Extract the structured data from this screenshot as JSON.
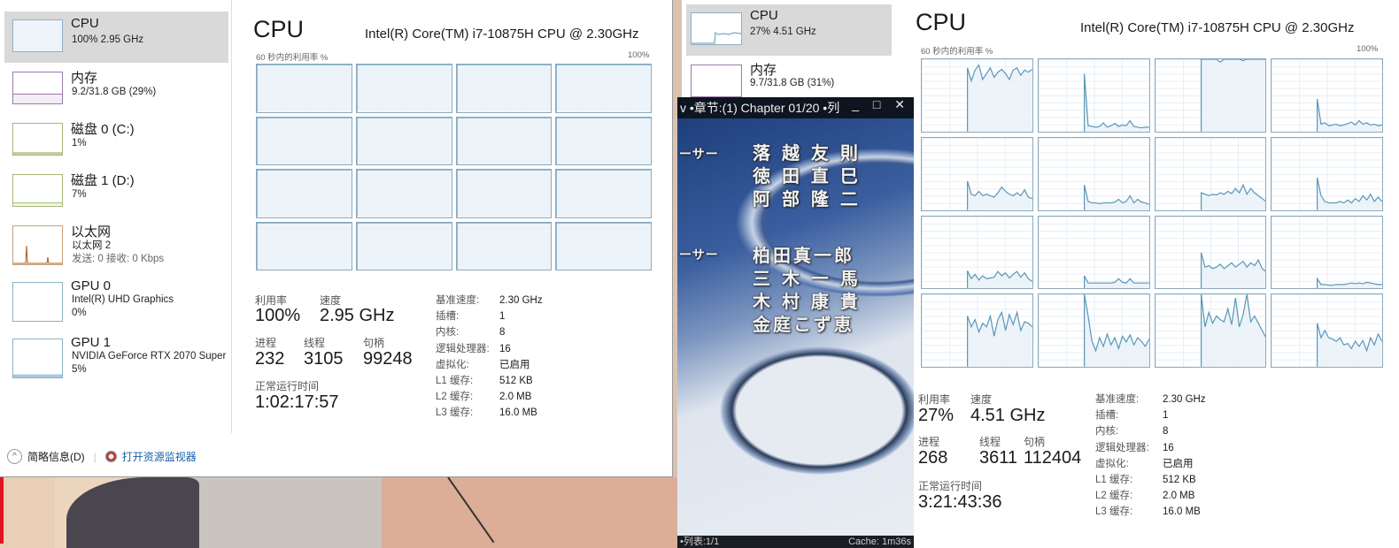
{
  "left_window": {
    "sidebar": [
      {
        "name": "CPU",
        "sub": "100% 2.95 GHz",
        "color": "#4f8fbf",
        "selected": true
      },
      {
        "name": "内存",
        "sub": "9.2/31.8 GB (29%)",
        "color": "#8b4f9f"
      },
      {
        "name": "磁盘 0 (C:)",
        "sub": "1%",
        "color": "#6a9a2a"
      },
      {
        "name": "磁盘 1 (D:)",
        "sub": "7%",
        "color": "#6a9a2a"
      },
      {
        "name": "以太网",
        "sub": "以太网 2",
        "sub2": "发送: 0 接收: 0 Kbps",
        "color": "#a75d1d"
      },
      {
        "name": "GPU 0",
        "sub": "Intel(R) UHD Graphics",
        "sub2": "0%",
        "color": "#4f8fbf"
      },
      {
        "name": "GPU 1",
        "sub": "NVIDIA GeForce RTX 2070 Super",
        "sub2": "5%",
        "color": "#4f8fbf"
      }
    ],
    "title": "CPU",
    "model": "Intel(R) Core(TM) i7-10875H CPU @ 2.30GHz",
    "graph_caption": "60 秒内的利用率 %",
    "graph_max": "100%",
    "core_utilization": [
      100,
      100,
      100,
      100,
      100,
      100,
      100,
      100,
      100,
      100,
      100,
      100,
      100,
      100,
      100,
      100
    ],
    "stats": {
      "util_label": "利用率",
      "util": "100%",
      "speed_label": "速度",
      "speed": "2.95 GHz",
      "proc_label": "进程",
      "proc": "232",
      "thread_label": "线程",
      "thread": "3105",
      "handle_label": "句柄",
      "handle": "99248",
      "uptime_label": "正常运行时间",
      "uptime": "1:02:17:57"
    },
    "specs": [
      {
        "k": "基准速度:",
        "v": "2.30 GHz"
      },
      {
        "k": "插槽:",
        "v": "1"
      },
      {
        "k": "内核:",
        "v": "8"
      },
      {
        "k": "逻辑处理器:",
        "v": "16"
      },
      {
        "k": "虚拟化:",
        "v": "已启用"
      },
      {
        "k": "L1 缓存:",
        "v": "512 KB"
      },
      {
        "k": "L2 缓存:",
        "v": "2.0 MB"
      },
      {
        "k": "L3 缓存:",
        "v": "16.0 MB"
      }
    ],
    "footer": {
      "brief": "简略信息(D)",
      "monitor": "打开资源监视器"
    }
  },
  "right_window": {
    "sidebar": [
      {
        "name": "CPU",
        "sub": "27% 4.51 GHz",
        "selected": true
      },
      {
        "name": "内存",
        "sub": "9.7/31.8 GB (31%)"
      }
    ],
    "title": "CPU",
    "model": "Intel(R) Core(TM) i7-10875H CPU @ 2.30GHz",
    "graph_caption": "60 秒内的利用率 %",
    "graph_max": "100%",
    "core_series": [
      [
        0,
        0,
        0,
        0,
        0,
        0,
        0,
        0,
        0,
        0,
        0,
        0,
        88,
        70,
        85,
        92,
        72,
        80,
        88,
        75,
        82,
        86,
        80,
        72,
        85,
        88,
        78,
        85,
        82,
        86
      ],
      [
        0,
        0,
        0,
        0,
        0,
        0,
        0,
        0,
        0,
        0,
        0,
        0,
        80,
        8,
        7,
        6,
        7,
        12,
        6,
        8,
        11,
        7,
        9,
        8,
        15,
        7,
        6,
        5,
        6,
        6
      ],
      [
        0,
        0,
        0,
        0,
        0,
        0,
        0,
        0,
        0,
        0,
        0,
        0,
        100,
        100,
        100,
        100,
        100,
        96,
        100,
        100,
        100,
        100,
        100,
        98,
        100,
        100,
        100,
        100,
        100,
        100
      ],
      [
        0,
        0,
        0,
        0,
        0,
        0,
        0,
        0,
        0,
        0,
        0,
        0,
        45,
        10,
        12,
        8,
        9,
        10,
        8,
        9,
        11,
        13,
        9,
        15,
        10,
        12,
        9,
        10,
        8,
        9
      ],
      [
        0,
        0,
        0,
        0,
        0,
        0,
        0,
        0,
        0,
        0,
        0,
        0,
        40,
        22,
        20,
        26,
        20,
        22,
        20,
        18,
        24,
        32,
        26,
        22,
        20,
        24,
        20,
        28,
        18,
        16
      ],
      [
        0,
        0,
        0,
        0,
        0,
        0,
        0,
        0,
        0,
        0,
        0,
        0,
        35,
        12,
        10,
        10,
        9,
        10,
        10,
        10,
        11,
        15,
        10,
        12,
        20,
        10,
        15,
        11,
        10,
        8
      ],
      [
        0,
        0,
        0,
        0,
        0,
        0,
        0,
        0,
        0,
        0,
        0,
        0,
        24,
        22,
        20,
        22,
        21,
        24,
        22,
        26,
        23,
        30,
        24,
        35,
        22,
        30,
        24,
        20,
        16,
        12
      ],
      [
        0,
        0,
        0,
        0,
        0,
        0,
        0,
        0,
        0,
        0,
        0,
        0,
        45,
        20,
        12,
        10,
        10,
        10,
        12,
        10,
        14,
        10,
        16,
        12,
        20,
        14,
        22,
        12,
        18,
        12
      ],
      [
        0,
        0,
        0,
        0,
        0,
        0,
        0,
        0,
        0,
        0,
        0,
        0,
        25,
        14,
        20,
        12,
        18,
        14,
        15,
        16,
        24,
        18,
        22,
        15,
        20,
        24,
        16,
        22,
        14,
        10
      ],
      [
        0,
        0,
        0,
        0,
        0,
        0,
        0,
        0,
        0,
        0,
        0,
        0,
        18,
        8,
        8,
        8,
        8,
        8,
        8,
        8,
        9,
        14,
        9,
        8,
        14,
        8,
        8,
        8,
        8,
        8
      ],
      [
        0,
        0,
        0,
        0,
        0,
        0,
        0,
        0,
        0,
        0,
        0,
        0,
        50,
        30,
        32,
        28,
        30,
        34,
        28,
        32,
        36,
        30,
        34,
        38,
        30,
        36,
        32,
        40,
        28,
        24
      ],
      [
        0,
        0,
        0,
        0,
        0,
        0,
        0,
        0,
        0,
        0,
        0,
        0,
        14,
        6,
        6,
        5,
        5,
        6,
        6,
        6,
        7,
        8,
        7,
        8,
        7,
        9,
        8,
        7,
        6,
        6
      ],
      [
        0,
        0,
        0,
        0,
        0,
        0,
        0,
        0,
        0,
        0,
        0,
        0,
        70,
        55,
        65,
        48,
        60,
        55,
        70,
        42,
        65,
        75,
        50,
        72,
        58,
        75,
        50,
        62,
        60,
        55
      ],
      [
        0,
        0,
        0,
        0,
        0,
        0,
        0,
        0,
        0,
        0,
        0,
        0,
        100,
        70,
        35,
        22,
        40,
        28,
        45,
        30,
        40,
        25,
        42,
        34,
        44,
        30,
        40,
        35,
        28,
        38
      ],
      [
        0,
        0,
        0,
        0,
        0,
        0,
        0,
        0,
        0,
        0,
        0,
        0,
        100,
        55,
        75,
        60,
        70,
        65,
        62,
        80,
        58,
        95,
        55,
        72,
        100,
        62,
        70,
        60,
        50,
        40
      ],
      [
        0,
        0,
        0,
        0,
        0,
        0,
        0,
        0,
        0,
        0,
        0,
        0,
        60,
        40,
        50,
        40,
        38,
        35,
        40,
        30,
        32,
        25,
        35,
        28,
        36,
        22,
        40,
        30,
        45,
        35
      ]
    ],
    "stats": {
      "util_label": "利用率",
      "util": "27%",
      "speed_label": "速度",
      "speed": "4.51 GHz",
      "proc_label": "进程",
      "proc": "268",
      "thread_label": "线程",
      "thread": "3611",
      "handle_label": "句柄",
      "handle": "112404",
      "uptime_label": "正常运行时间",
      "uptime": "3:21:43:36"
    },
    "specs": [
      {
        "k": "基准速度:",
        "v": "2.30 GHz"
      },
      {
        "k": "插槽:",
        "v": "1"
      },
      {
        "k": "内核:",
        "v": "8"
      },
      {
        "k": "逻辑处理器:",
        "v": "16"
      },
      {
        "k": "虚拟化:",
        "v": "已启用"
      },
      {
        "k": "L1 缓存:",
        "v": "512 KB"
      },
      {
        "k": "L2 缓存:",
        "v": "2.0 MB"
      },
      {
        "k": "L3 缓存:",
        "v": "16.0 MB"
      }
    ]
  },
  "player": {
    "title": "v •章节:(1) Chapter 01/20 •列",
    "controls": "_ □ ✕",
    "subtitles_left": [
      "ーサー",
      "ーサー"
    ],
    "subtitles_group1": [
      "落 越 友 則",
      "徳 田 直 巳",
      "阿 部 隆 二"
    ],
    "subtitles_group2": [
      "柏田真一郎",
      "三 木 一 馬",
      "木 村 康 貴",
      "金庭こず恵"
    ],
    "status_left": "•列表:1/1",
    "status_right": "Cache: 1m36s"
  },
  "colors": {
    "cpu_line": "#5a97b8",
    "cpu_fill": "#eaf2f8",
    "grid_border": "#8aa9bf",
    "selected_bg": "#d9d9d9",
    "link": "#1a5fa8",
    "accent_red": "#e0141e"
  }
}
